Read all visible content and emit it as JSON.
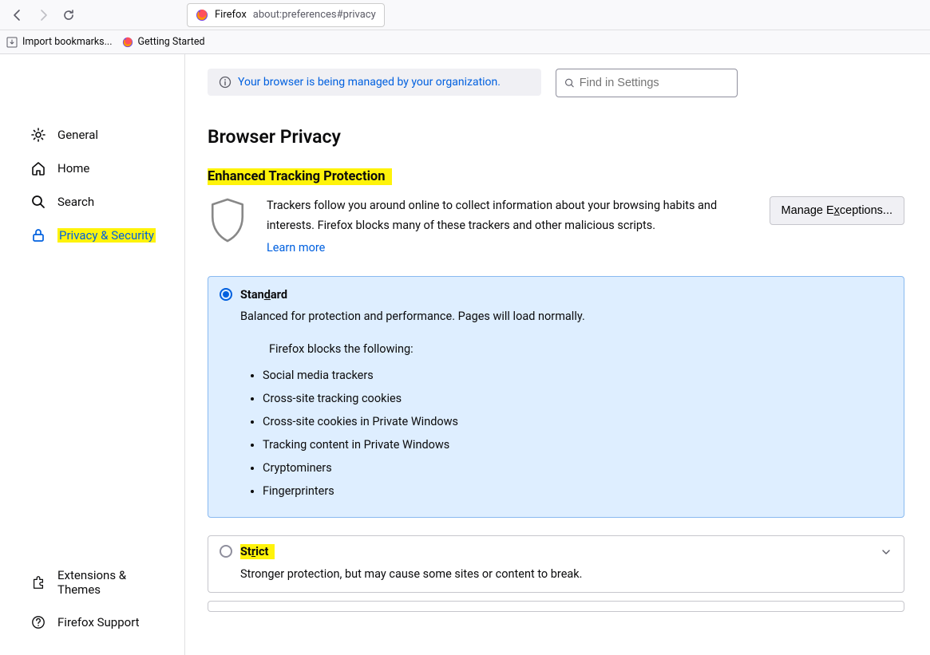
{
  "toolbar": {
    "identity_label": "Firefox",
    "url_text": "about:preferences#privacy"
  },
  "bookmarks": {
    "import_label": "Import bookmarks...",
    "getting_started_label": "Getting Started"
  },
  "sidebar": {
    "general": "General",
    "home": "Home",
    "search": "Search",
    "privacy": "Privacy & Security",
    "extensions": "Extensions & Themes",
    "support": "Firefox Support"
  },
  "banner": {
    "managed_text": "Your browser is being managed by your organization."
  },
  "search_settings": {
    "placeholder": "Find in Settings"
  },
  "page": {
    "title": "Browser Privacy",
    "section": "Enhanced Tracking Protection",
    "description": "Trackers follow you around online to collect information about your browsing habits and interests. Firefox blocks many of these trackers and other malicious scripts.",
    "learn_more": "Learn more",
    "manage_exceptions_pre": "Manage E",
    "manage_exceptions_u": "x",
    "manage_exceptions_post": "ceptions..."
  },
  "standard": {
    "title_pre": "Stan",
    "title_u": "d",
    "title_post": "ard",
    "subtitle": "Balanced for protection and performance. Pages will load normally.",
    "blocks_intro": "Firefox blocks the following:",
    "items": [
      "Social media trackers",
      "Cross-site tracking cookies",
      "Cross-site cookies in Private Windows",
      "Tracking content in Private Windows",
      "Cryptominers",
      "Fingerprinters"
    ]
  },
  "strict": {
    "title_pre": "St",
    "title_u": "r",
    "title_post": "ict",
    "subtitle": "Stronger protection, but may cause some sites or content to break."
  }
}
